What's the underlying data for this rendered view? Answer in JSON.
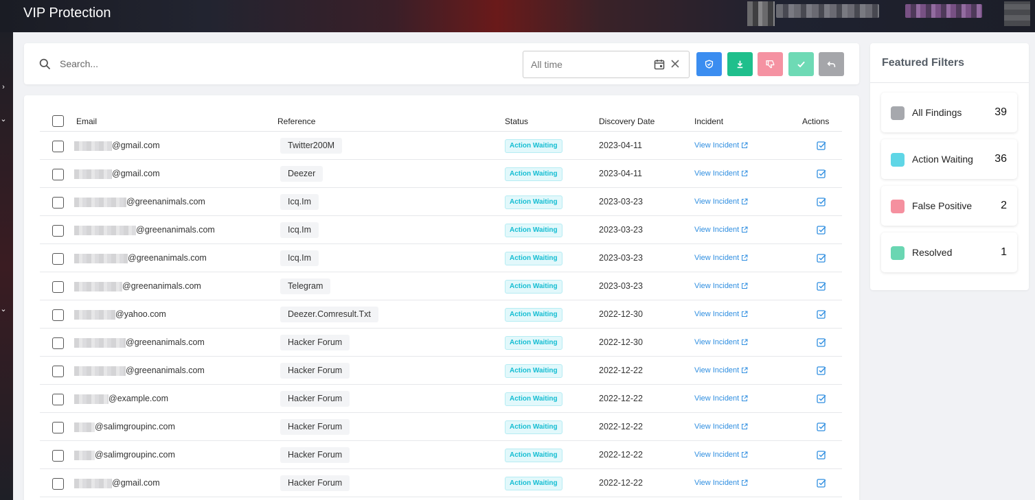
{
  "app": {
    "title": "VIP Protection"
  },
  "search": {
    "placeholder": "Search..."
  },
  "date_filter": {
    "placeholder": "All time"
  },
  "toolbar": {
    "buttons": [
      {
        "name": "shield-button",
        "icon": "shield-icon",
        "color": "#3b8df0"
      },
      {
        "name": "download-button",
        "icon": "download-icon",
        "color": "#1fbf8c"
      },
      {
        "name": "false-positive-button",
        "icon": "thumbs-down-icon",
        "color": "#f592a2"
      },
      {
        "name": "resolve-button",
        "icon": "check-icon",
        "color": "#6edab5"
      },
      {
        "name": "undo-button",
        "icon": "undo-icon",
        "color": "#a5a6aa"
      }
    ]
  },
  "table": {
    "headers": {
      "email": "Email",
      "reference": "Reference",
      "status": "Status",
      "date": "Discovery Date",
      "incident": "Incident",
      "actions": "Actions"
    },
    "rows": [
      {
        "email": "@gmail.com",
        "reference": "Twitter200M",
        "status": "Action Waiting",
        "date": "2023-04-11",
        "incident": "View Incident"
      },
      {
        "email": "@gmail.com",
        "reference": "Deezer",
        "status": "Action Waiting",
        "date": "2023-04-11",
        "incident": "View Incident"
      },
      {
        "email": "@greenanimals.com",
        "reference": "Icq.Im",
        "status": "Action Waiting",
        "date": "2023-03-23",
        "incident": "View Incident"
      },
      {
        "email": "@greenanimals.com",
        "reference": "Icq.Im",
        "status": "Action Waiting",
        "date": "2023-03-23",
        "incident": "View Incident"
      },
      {
        "email": "@greenanimals.com",
        "reference": "Icq.Im",
        "status": "Action Waiting",
        "date": "2023-03-23",
        "incident": "View Incident"
      },
      {
        "email": "@greenanimals.com",
        "reference": "Telegram",
        "status": "Action Waiting",
        "date": "2023-03-23",
        "incident": "View Incident"
      },
      {
        "email": "@yahoo.com",
        "reference": "Deezer.Comresult.Txt",
        "status": "Action Waiting",
        "date": "2022-12-30",
        "incident": "View Incident"
      },
      {
        "email": "@greenanimals.com",
        "reference": "Hacker Forum",
        "status": "Action Waiting",
        "date": "2022-12-30",
        "incident": "View Incident"
      },
      {
        "email": "@greenanimals.com",
        "reference": "Hacker Forum",
        "status": "Action Waiting",
        "date": "2022-12-22",
        "incident": "View Incident"
      },
      {
        "email": "@example.com",
        "reference": "Hacker Forum",
        "status": "Action Waiting",
        "date": "2022-12-22",
        "incident": "View Incident"
      },
      {
        "email": "@salimgroupinc.com",
        "reference": "Hacker Forum",
        "status": "Action Waiting",
        "date": "2022-12-22",
        "incident": "View Incident"
      },
      {
        "email": "@salimgroupinc.com",
        "reference": "Hacker Forum",
        "status": "Action Waiting",
        "date": "2022-12-22",
        "incident": "View Incident"
      },
      {
        "email": "@gmail.com",
        "reference": "Hacker Forum",
        "status": "Action Waiting",
        "date": "2022-12-22",
        "incident": "View Incident"
      }
    ]
  },
  "featured_filters": {
    "title": "Featured Filters",
    "items": [
      {
        "label": "All Findings",
        "count": "39",
        "color": "#a6a8ad"
      },
      {
        "label": "Action Waiting",
        "count": "36",
        "color": "#5fd6e6"
      },
      {
        "label": "False Positive",
        "count": "2",
        "color": "#f5909f"
      },
      {
        "label": "Resolved",
        "count": "1",
        "color": "#6ad6b2"
      }
    ]
  },
  "colors": {
    "accent": "#2f8ee0",
    "status_text": "#14bdd2",
    "status_bg": "#e2f8fb"
  }
}
